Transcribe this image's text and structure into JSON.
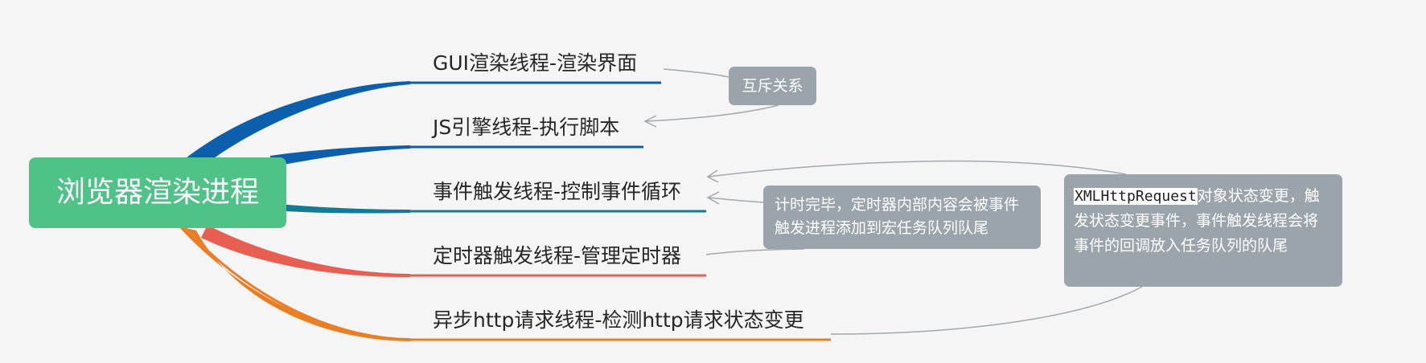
{
  "root": {
    "label": "浏览器渲染进程"
  },
  "branches": [
    {
      "label": "GUI渲染线程-渲染界面",
      "color": "#0b5fad"
    },
    {
      "label": "JS引擎线程-执行脚本",
      "color": "#0b5fad"
    },
    {
      "label": "事件触发线程-控制事件循环",
      "color": "#137c94"
    },
    {
      "label": "定时器触发线程-管理定时器",
      "color": "#e85f52"
    },
    {
      "label": "异步http请求线程-检测http请求状态变更",
      "color": "#ea7e25"
    }
  ],
  "notes": {
    "mutex": "互斥关系",
    "timer": "计时完毕，定时器内部内容会被事件触发进程添加到宏任务队列队尾",
    "xhr_code": "XMLHttpRequest",
    "xhr_text": "对象状态变更，触发状态变更事件，事件触发线程会将事件的回调放入任务队列的队尾"
  },
  "colors": {
    "background": "#f5f5f5",
    "root": "#4fc287",
    "note": "#9ba3ab",
    "connector": "#a3a8ad"
  }
}
